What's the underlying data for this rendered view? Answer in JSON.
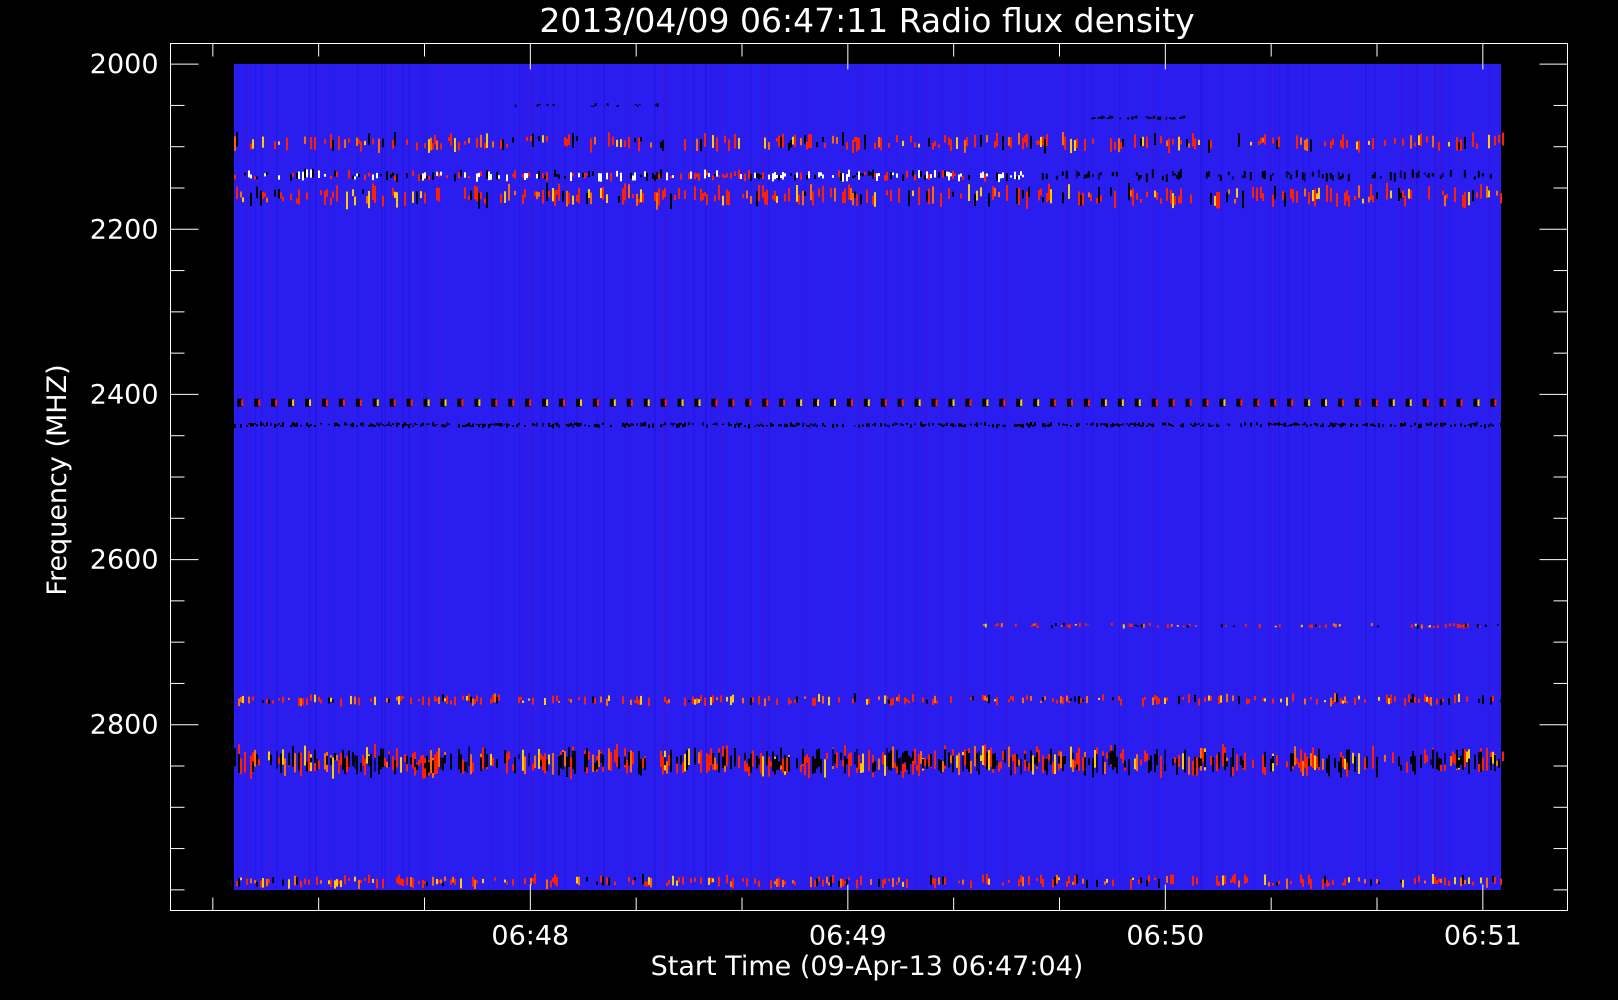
{
  "chart_data": {
    "type": "heatmap",
    "title": "2013/04/09 06:47:11 Radio flux density",
    "xlabel": "Start Time (09-Apr-13 06:47:04)",
    "ylabel": "Frequency (MHZ)",
    "x_ticks": [
      {
        "label": "06:48",
        "t": 56
      },
      {
        "label": "06:49",
        "t": 116
      },
      {
        "label": "06:50",
        "t": 176
      },
      {
        "label": "06:51",
        "t": 236
      }
    ],
    "y_ticks": [
      2000,
      2200,
      2400,
      2600,
      2800
    ],
    "xlim_seconds": [
      -12,
      252
    ],
    "ylim": [
      1975,
      3025
    ],
    "data_time_range_seconds": [
      0,
      240
    ],
    "data_freq_range": [
      2000,
      3000
    ],
    "background_color": "#2a1df0",
    "emission_colors": [
      "#ff2000",
      "#ffcc00",
      "#ffffff",
      "#000000"
    ],
    "bands": [
      {
        "freq_center": 2050,
        "half_width": 2,
        "style": "dark-sparse",
        "density": 0.15,
        "t_range": [
          50,
          80
        ]
      },
      {
        "freq_center": 2065,
        "half_width": 2,
        "style": "dark-line",
        "density": 0.6,
        "t_range": [
          162,
          180
        ]
      },
      {
        "freq_center": 2095,
        "half_width": 10,
        "style": "red-mixed",
        "density": 0.35,
        "t_range": [
          0,
          240
        ]
      },
      {
        "freq_center": 2135,
        "half_width": 6,
        "style": "white-hot",
        "density": 0.55,
        "t_range": [
          0,
          150
        ]
      },
      {
        "freq_center": 2135,
        "half_width": 6,
        "style": "dark-line",
        "density": 0.35,
        "t_range": [
          150,
          240
        ]
      },
      {
        "freq_center": 2160,
        "half_width": 12,
        "style": "red-mixed",
        "density": 0.4,
        "t_range": [
          0,
          240
        ]
      },
      {
        "freq_center": 2410,
        "half_width": 8,
        "style": "dotted-burst",
        "density": 0.9,
        "t_range": [
          0,
          240
        ]
      },
      {
        "freq_center": 2437,
        "half_width": 3,
        "style": "dark-line",
        "density": 0.6,
        "t_range": [
          0,
          240
        ]
      },
      {
        "freq_center": 2680,
        "half_width": 3,
        "style": "red-mixed",
        "density": 0.3,
        "t_range": [
          140,
          240
        ]
      },
      {
        "freq_center": 2770,
        "half_width": 6,
        "style": "red-mixed",
        "density": 0.35,
        "t_range": [
          0,
          240
        ]
      },
      {
        "freq_center": 2845,
        "half_width": 16,
        "style": "red-mixed",
        "density": 0.55,
        "t_range": [
          0,
          240
        ]
      },
      {
        "freq_center": 2845,
        "half_width": 14,
        "style": "dark-line",
        "density": 0.3,
        "t_range": [
          0,
          240
        ]
      },
      {
        "freq_center": 2990,
        "half_width": 7,
        "style": "red-mixed",
        "density": 0.4,
        "t_range": [
          0,
          240
        ]
      }
    ]
  }
}
